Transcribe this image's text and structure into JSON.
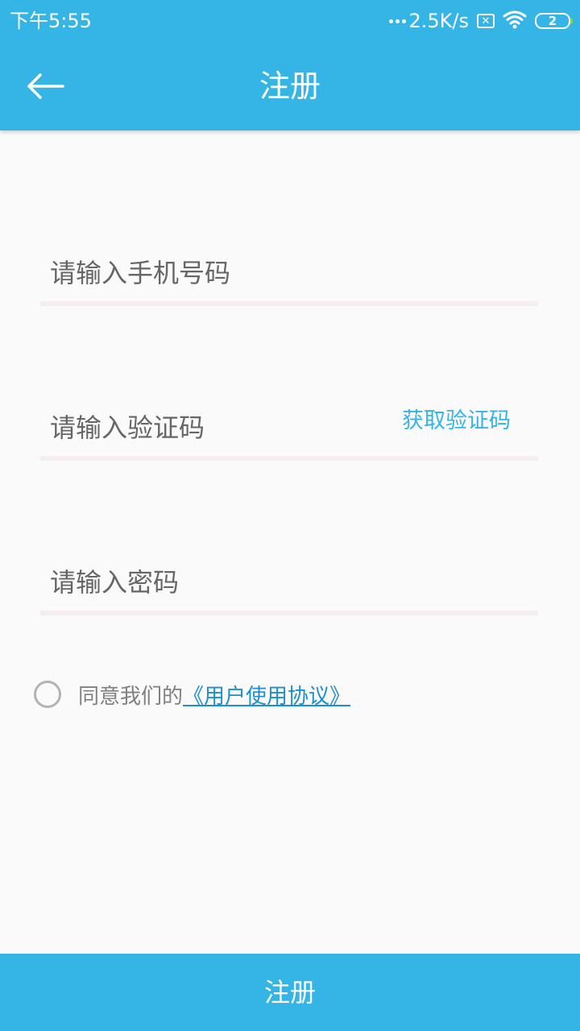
{
  "status_bar": {
    "time": "下午5:55",
    "network_speed": "2.5K/s",
    "sim_icon": "sim-x-icon",
    "wifi_icon": "wifi-icon",
    "battery_level": "2",
    "battery_icon": "battery-icon"
  },
  "toolbar": {
    "back_icon": "arrow-left-icon",
    "title": "注册"
  },
  "form": {
    "phone": {
      "placeholder": "请输入手机号码",
      "value": ""
    },
    "code": {
      "placeholder": "请输入验证码",
      "value": "",
      "get_code_label": "获取验证码"
    },
    "password": {
      "placeholder": "请输入密码",
      "value": ""
    }
  },
  "agreement": {
    "checked": false,
    "prefix": "同意我们的",
    "link_text": "《用户使用协议》"
  },
  "register_button": {
    "label": "注册"
  },
  "colors": {
    "primary": "#35b4e6",
    "link": "#1a8fd1",
    "underline": "#f6edf0",
    "background": "#fafafa"
  }
}
